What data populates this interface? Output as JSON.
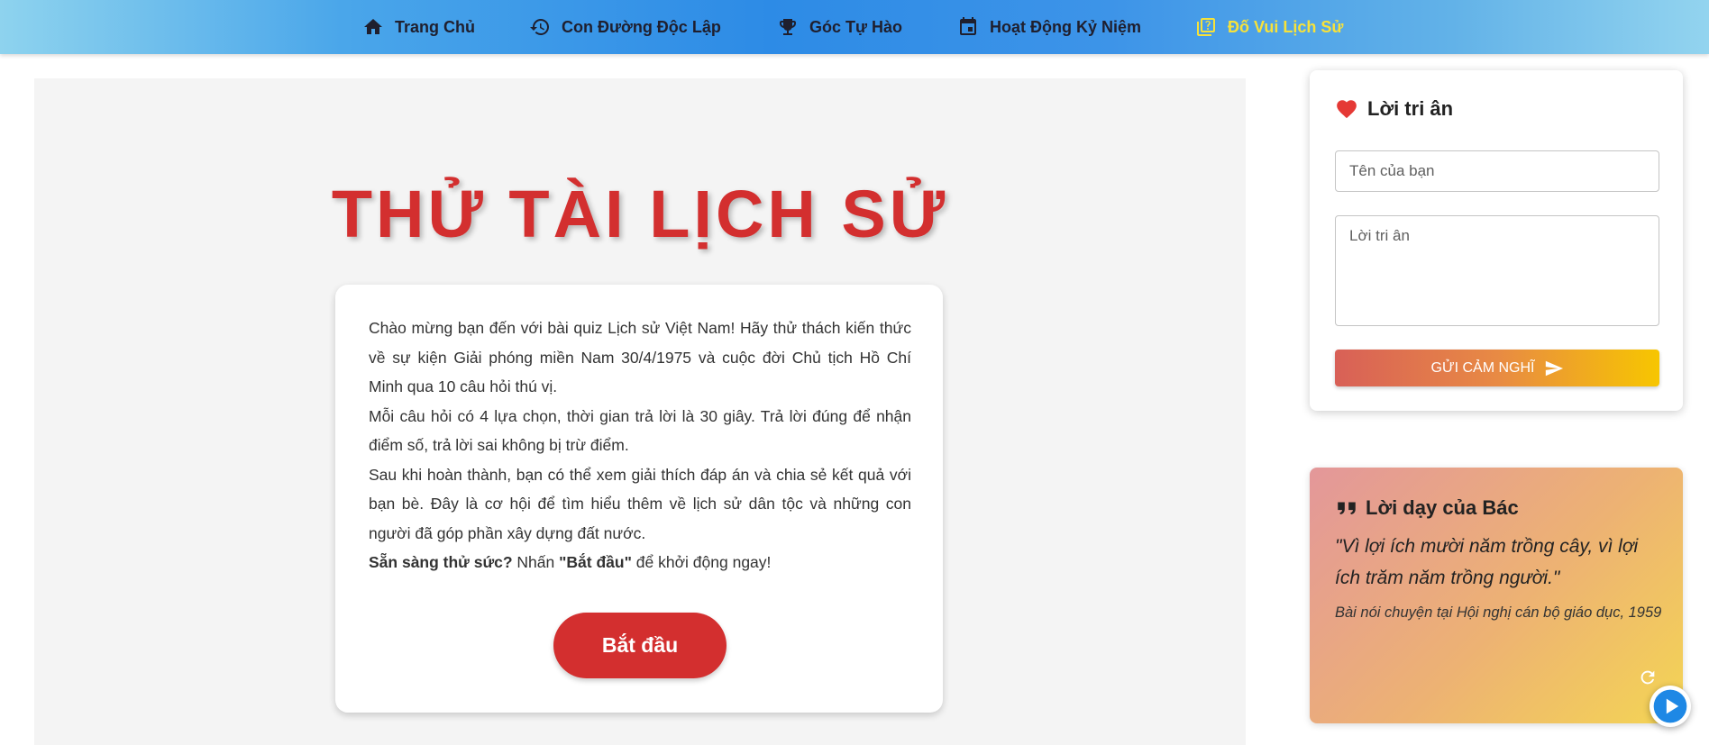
{
  "nav": {
    "items": [
      {
        "label": "Trang Chủ",
        "icon": "home-icon"
      },
      {
        "label": "Con Đường Độc Lập",
        "icon": "history-icon"
      },
      {
        "label": "Góc Tự Hào",
        "icon": "trophy-icon"
      },
      {
        "label": "Hoạt Động Kỷ Niệm",
        "icon": "calendar-icon"
      },
      {
        "label": "Đố Vui Lịch Sử",
        "icon": "quiz-icon",
        "active": true
      }
    ],
    "active_color": "#f7e23a"
  },
  "quiz": {
    "title": "THỬ TÀI LỊCH SỬ",
    "paragraphs": [
      "Chào mừng bạn đến với bài quiz Lịch sử Việt Nam! Hãy thử thách kiến thức về sự kiện Giải phóng miền Nam 30/4/1975 và cuộc đời Chủ tịch Hồ Chí Minh qua 10 câu hỏi thú vị.",
      "Mỗi câu hỏi có 4 lựa chọn, thời gian trả lời là 30 giây. Trả lời đúng để nhận điểm số, trả lời sai không bị trừ điểm.",
      "Sau khi hoàn thành, bạn có thể xem giải thích đáp án và chia sẻ kết quả với bạn bè. Đây là cơ hội để tìm hiểu thêm về lịch sử dân tộc và những con người đã góp phần xây dựng đất nước."
    ],
    "ready_bold": "Sẵn sàng thử sức?",
    "ready_mid": " Nhấn ",
    "ready_start_bold": "\"Bắt đầu\"",
    "ready_end": " để khởi động ngay!",
    "start_label": "Bắt đầu",
    "accent_color": "#d32f2f"
  },
  "thanks": {
    "title": "Lời tri ân",
    "name_placeholder": "Tên của bạn",
    "message_placeholder": "Lời tri ân",
    "send_label": "GỬI CẢM NGHĨ"
  },
  "teaching": {
    "title": "Lời dạy của Bác",
    "quote": "\"Vì lợi ích mười năm trồng cây, vì lợi ích trăm năm trồng người.\"",
    "source": "Bài nói chuyện tại Hội nghị cán bộ giáo dục, 1959"
  }
}
